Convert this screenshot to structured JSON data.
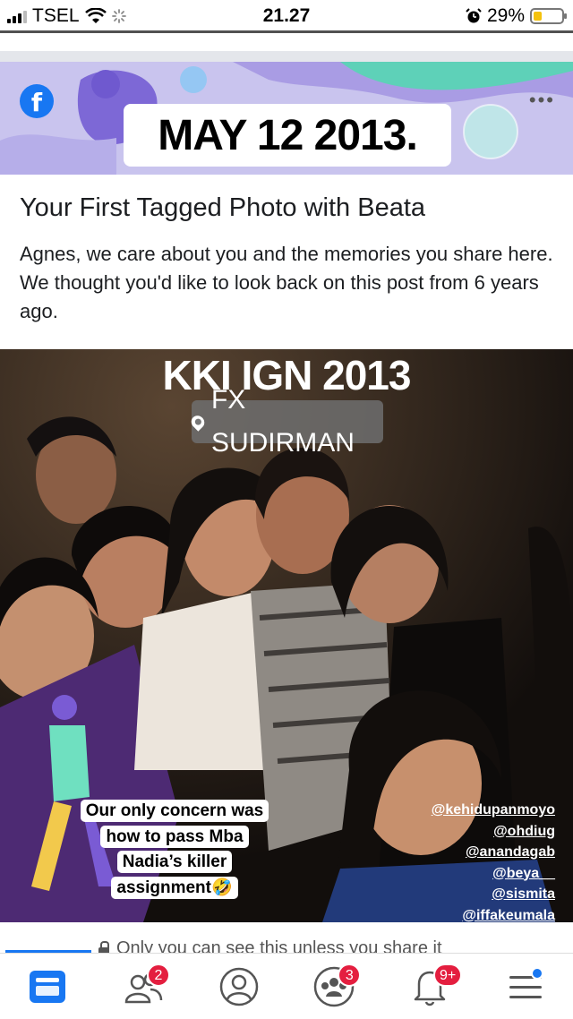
{
  "status_bar": {
    "carrier": "TSEL",
    "time": "21.27",
    "battery_percent": "29%",
    "battery_level": 0.29
  },
  "memory_card": {
    "date": "MAY 12 2013.",
    "title": "Your First Tagged Photo with Beata",
    "description": "Agnes, we care about you and the memories you share here. We thought you'd like to look back on this post from 6 years ago.",
    "icons": [
      "facebook-icon",
      "more-options-icon"
    ]
  },
  "photo": {
    "title": "KKI IGN 2013",
    "location": "FX SUDIRMAN",
    "mentions": [
      "@kehidupanmoyo",
      "@ohdiug",
      "@anandagab",
      "@beya__",
      "@sismita",
      "@iffakeumala"
    ],
    "caption": "Our only concern was how to pass Mba Nadia’s killer assignment🤣"
  },
  "share": {
    "text": "Only you can see this unless you share it"
  },
  "tabbar": {
    "tabs": [
      {
        "name": "news-feed",
        "icon": "news-feed-icon",
        "active": true,
        "badge": ""
      },
      {
        "name": "friends",
        "icon": "friends-icon",
        "active": false,
        "badge": "2"
      },
      {
        "name": "profile",
        "icon": "profile-icon",
        "active": false,
        "badge": ""
      },
      {
        "name": "groups",
        "icon": "groups-icon",
        "active": false,
        "badge": "3"
      },
      {
        "name": "notifications",
        "icon": "bell-icon",
        "active": false,
        "badge": "9+"
      },
      {
        "name": "menu",
        "icon": "hamburger-menu-icon",
        "active": false,
        "badge": ""
      }
    ]
  },
  "colors": {
    "facebook_blue": "#1877f2",
    "badge_red": "#e41e3f",
    "banner_lavender": "#c9c4ee"
  }
}
